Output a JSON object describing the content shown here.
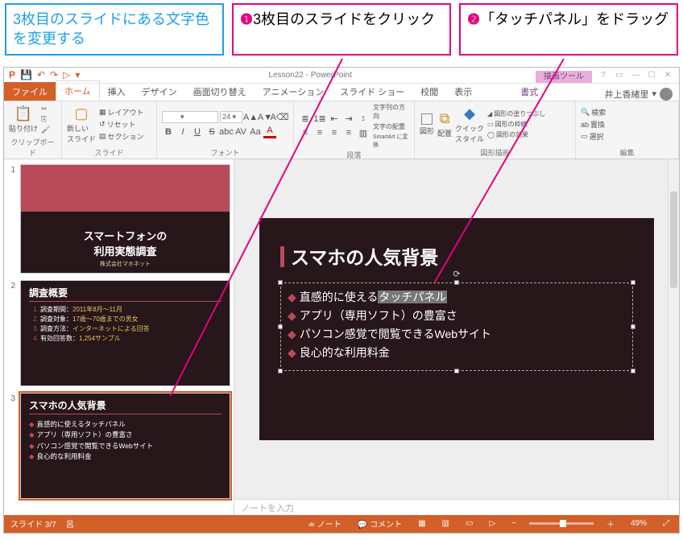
{
  "instructions": {
    "blue": "3枚目のスライドにある文字色を変更する",
    "step1_num": "❶",
    "step1_text": "3枚目のスライドをクリック",
    "step2_num": "❷",
    "step2_text": "「タッチパネル」をドラッグ"
  },
  "titlebar": {
    "doc": "Lesson22 - PowerPoint",
    "context_tool": "描画ツール",
    "help_icon": "?",
    "ribbon_opts_icon": "▭",
    "min_icon": "—",
    "max_icon": "☐",
    "close_icon": "✕"
  },
  "qat": {
    "app_icon": "P",
    "save": "💾",
    "undo": "↶",
    "redo": "↷",
    "start": "▷",
    "more": "▾"
  },
  "tabs": {
    "file": "ファイル",
    "home": "ホーム",
    "insert": "挿入",
    "design": "デザイン",
    "transitions": "画面切り替え",
    "animations": "アニメーション",
    "slideshow": "スライド ショー",
    "review": "校閲",
    "view": "表示",
    "format": "書式"
  },
  "account": {
    "name": "井上香緒里",
    "menu": "▾"
  },
  "ribbon": {
    "clipboard": {
      "paste": "貼り付け",
      "label": "クリップボード",
      "cut_ic": "✂",
      "copy_ic": "⎘",
      "fmt_ic": "🖌"
    },
    "slides": {
      "new": "新しい\nスライド",
      "layout": "レイアウト",
      "reset": "リセット",
      "section": "セクション",
      "label": "スライド",
      "layout_ic": "▦",
      "reset_ic": "↺",
      "section_ic": "▤"
    },
    "font": {
      "family_ph": " ",
      "size": "24",
      "grow": "A▲",
      "shrink": "A▼",
      "clear": "A⌫",
      "b": "B",
      "i": "I",
      "u": "U",
      "s": "S",
      "shadow": "abc",
      "spacing": "AV",
      "case": "Aa",
      "color_ic": "A",
      "label": "フォント"
    },
    "para": {
      "bullets": "≣",
      "numbers": "1≣",
      "indent_dec": "⇤",
      "indent_inc": "⇥",
      "sort": "A↓",
      "al": "≡",
      "ac": "≡",
      "ar": "≡",
      "aj": "≡",
      "cols": "▥",
      "linesp": "↕",
      "dir": "文字列の方向",
      "align_v": "文字の配置",
      "smartart": "SmartArt に変換",
      "label": "段落"
    },
    "drawing": {
      "shapes": "図形",
      "arrange": "配置",
      "quick": "クイック\nスタイル",
      "fill": "図形の塗りつぶし",
      "outline": "図形の枠線",
      "effects": "図形の効果",
      "label": "図形描画"
    },
    "editing": {
      "find": "検索",
      "replace": "置換",
      "select": "選択",
      "label": "編集",
      "find_ic": "🔍",
      "replace_ic": "ab",
      "select_ic": "▭"
    }
  },
  "thumbs": {
    "n1": "1",
    "n2": "2",
    "n3": "3",
    "t1_title": "スマートフォンの\n利用実態調査",
    "t1_sub": "株式会社マホネット",
    "t2_title": "調査概要",
    "t2_i1_l": "調査期間：",
    "t2_i1_v": "2011年8月～11月",
    "t2_i2_l": "調査対象：",
    "t2_i2_v": "17歳～70歳までの男女",
    "t2_i3_l": "調査方法：",
    "t2_i3_v": "インターネットによる回答",
    "t2_i4_l": "有効回答数：",
    "t2_i4_v": "1,254サンプル",
    "t3_title": "スマホの人気背景",
    "t3_b1": "直感的に使えるタッチパネル",
    "t3_b2": "アプリ（専用ソフト）の豊富さ",
    "t3_b3": "パソコン感覚で閲覧できるWebサイト",
    "t3_b4": "良心的な利用料金"
  },
  "slide": {
    "title": "スマホの人気背景",
    "b1_pre": "直感的に使える",
    "b1_hl": "タッチパネル",
    "b2": "アプリ（専用ソフト）の豊富さ",
    "b3": "パソコン感覚で閲覧できるWebサイト",
    "b4": "良心的な利用料金",
    "rot": "⟳"
  },
  "notes": {
    "placeholder": "ノートを入力"
  },
  "status": {
    "slide": "スライド 3/7",
    "lang_ic": "呂",
    "notes": "ノート",
    "comments": "コメント",
    "v_normal": "▦",
    "v_sorter": "▥",
    "v_read": "▭",
    "v_show": "▷",
    "zoom_out": "−",
    "zoom_in": "＋",
    "zoom": "49%",
    "fit": "⤢"
  }
}
